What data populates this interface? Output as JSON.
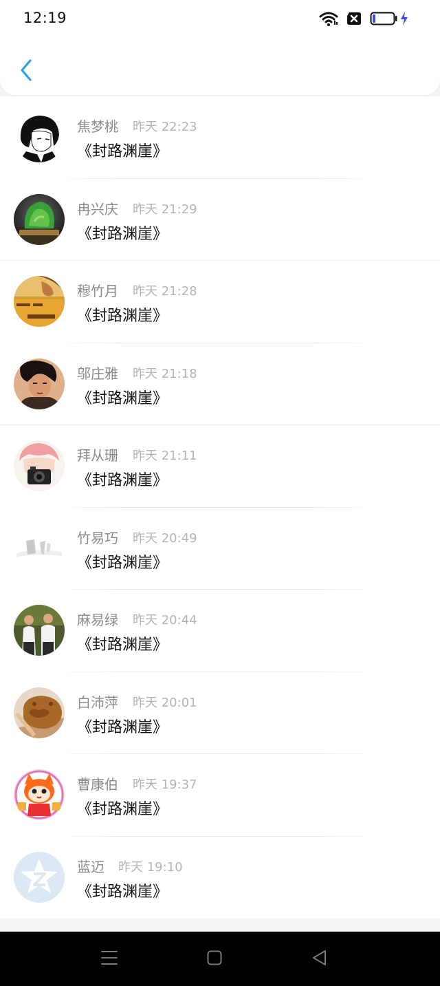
{
  "status_bar": {
    "time": "12:19",
    "icons": [
      "wifi-icon",
      "sim-error-icon",
      "battery-icon",
      "charging-icon"
    ],
    "colors": {
      "battery_fill": "#3a50e0",
      "charging": "#3a50e0"
    }
  },
  "header": {
    "back_icon": "chevron-left-icon",
    "accent": "#2aa0e8"
  },
  "list": {
    "items": [
      {
        "name": "焦梦桃",
        "time": "昨天 22:23",
        "message": "《封路渊崖》",
        "avatar": "anime-boy-avatar"
      },
      {
        "name": "冉兴庆",
        "time": "昨天 21:29",
        "message": "《封路渊崖》",
        "avatar": "green-plant-avatar"
      },
      {
        "name": "穆竹月",
        "time": "昨天 21:28",
        "message": "《封路渊崖》",
        "avatar": "golden-photo-avatar"
      },
      {
        "name": "邬庄雅",
        "time": "昨天 21:18",
        "message": "《封路渊崖》",
        "avatar": "woman-portrait-avatar"
      },
      {
        "name": "拜从珊",
        "time": "昨天 21:11",
        "message": "《封路渊崖》",
        "avatar": "camera-girl-avatar"
      },
      {
        "name": "竹易巧",
        "time": "昨天 20:49",
        "message": "《封路渊崖》",
        "avatar": "faded-scene-avatar"
      },
      {
        "name": "麻易绿",
        "time": "昨天 20:44",
        "message": "《封路渊崖》",
        "avatar": "two-people-avatar"
      },
      {
        "name": "白沛萍",
        "time": "昨天 20:01",
        "message": "《封路渊崖》",
        "avatar": "cookie-avatar"
      },
      {
        "name": "曹康伯",
        "time": "昨天 19:37",
        "message": "《封路渊崖》",
        "avatar": "cartoon-fox-avatar"
      },
      {
        "name": "蓝迈",
        "time": "昨天 19:10",
        "message": "《封路渊崖》",
        "avatar": "default-star-avatar"
      }
    ]
  },
  "nav_bar": {
    "icons": [
      "menu-icon",
      "home-icon",
      "back-triangle-icon"
    ]
  }
}
